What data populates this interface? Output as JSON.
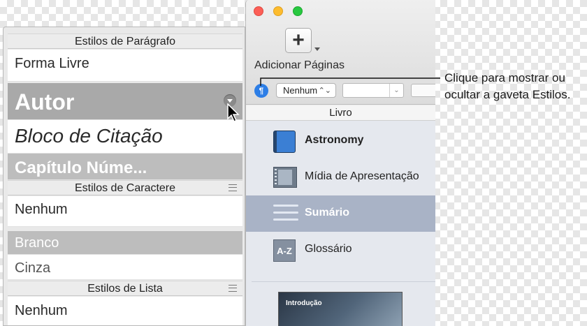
{
  "styles_drawer": {
    "paragraph_header": "Estilos de Parágrafo",
    "paragraph_styles": [
      "Forma Livre",
      "Autor",
      "Bloco de Citação",
      "Capítulo Núme..."
    ],
    "character_header": "Estilos de Caractere",
    "character_styles": [
      "Nenhum",
      "Branco",
      "Cinza"
    ],
    "list_header": "Estilos de Lista",
    "list_styles": [
      "Nenhum"
    ]
  },
  "toolbar": {
    "add_pages_label": "Adicionar Páginas",
    "add_pages_symbol": "+",
    "pilcrow": "¶",
    "style_popup_value": "Nenhum"
  },
  "sidebar": {
    "header": "Livro",
    "items": [
      {
        "label": "Astronomy",
        "icon": "book-icon"
      },
      {
        "label": "Mídia de Apresentação",
        "icon": "film-icon"
      },
      {
        "label": "Sumário",
        "icon": "list-icon",
        "selected": true
      },
      {
        "label": "Glossário",
        "icon": "az-icon",
        "icon_text": "A-Z"
      }
    ],
    "thumbnail_label": "Introdução"
  },
  "callout": {
    "line1": "Clique para mostrar ou",
    "line2": "ocultar a gaveta Estilos."
  },
  "colors": {
    "accent_blue": "#2d7ee6",
    "selected_row": "#a9b3c6",
    "selected_style": "#a9a9a9"
  }
}
